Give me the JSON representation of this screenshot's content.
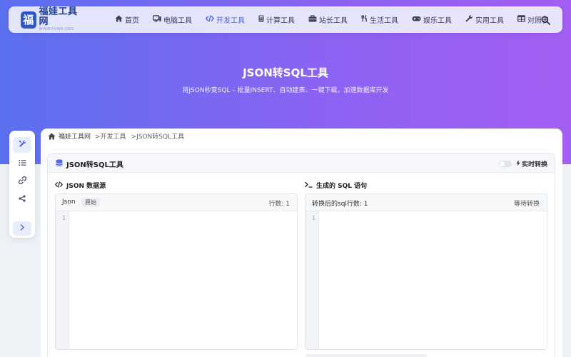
{
  "brand": {
    "name": "福娃工具网",
    "subtitle": "WWW.FUWA.ORG",
    "mark": "福"
  },
  "nav": {
    "items": [
      {
        "label": "首页",
        "icon": "home-icon",
        "active": false
      },
      {
        "label": "电脑工具",
        "icon": "computer-icon",
        "active": false
      },
      {
        "label": "开发工具",
        "icon": "code-icon",
        "active": true
      },
      {
        "label": "计算工具",
        "icon": "calculator-icon",
        "active": false
      },
      {
        "label": "站长工具",
        "icon": "toolbox-icon",
        "active": false
      },
      {
        "label": "生活工具",
        "icon": "utensils-icon",
        "active": false
      },
      {
        "label": "娱乐工具",
        "icon": "gamepad-icon",
        "active": false
      },
      {
        "label": "实用工具",
        "icon": "wrench-icon",
        "active": false
      },
      {
        "label": "对照表",
        "icon": "table-icon",
        "active": false
      }
    ]
  },
  "hero": {
    "title": "JSON转SQL工具",
    "subtitle": "将JSON秒变SQL – 批量INSERT、自动建表、一键下载，加速数据库开发"
  },
  "breadcrumb": {
    "home": "福娃工具网",
    "items": [
      ">开发工具",
      ">JSON转SQL工具"
    ]
  },
  "panel": {
    "title": "JSON转SQL工具",
    "realtime_label": "实时转换",
    "realtime_enabled": false
  },
  "input_section": {
    "title": "JSON 数据源",
    "editor_label": "Json",
    "tag": "原始",
    "line_count": "行数: 1",
    "line_numbers": [
      "1"
    ]
  },
  "output_section": {
    "title": "生成的 SQL 语句",
    "editor_label": "转换后的sql行数: 1",
    "status": "等待转换",
    "line_numbers": [
      "1"
    ]
  },
  "colors": {
    "accent": "#4e67e6",
    "hero_gradient_start": "#5b70f0",
    "hero_gradient_end": "#a45ef2",
    "brand_blue": "#2f57c9"
  }
}
